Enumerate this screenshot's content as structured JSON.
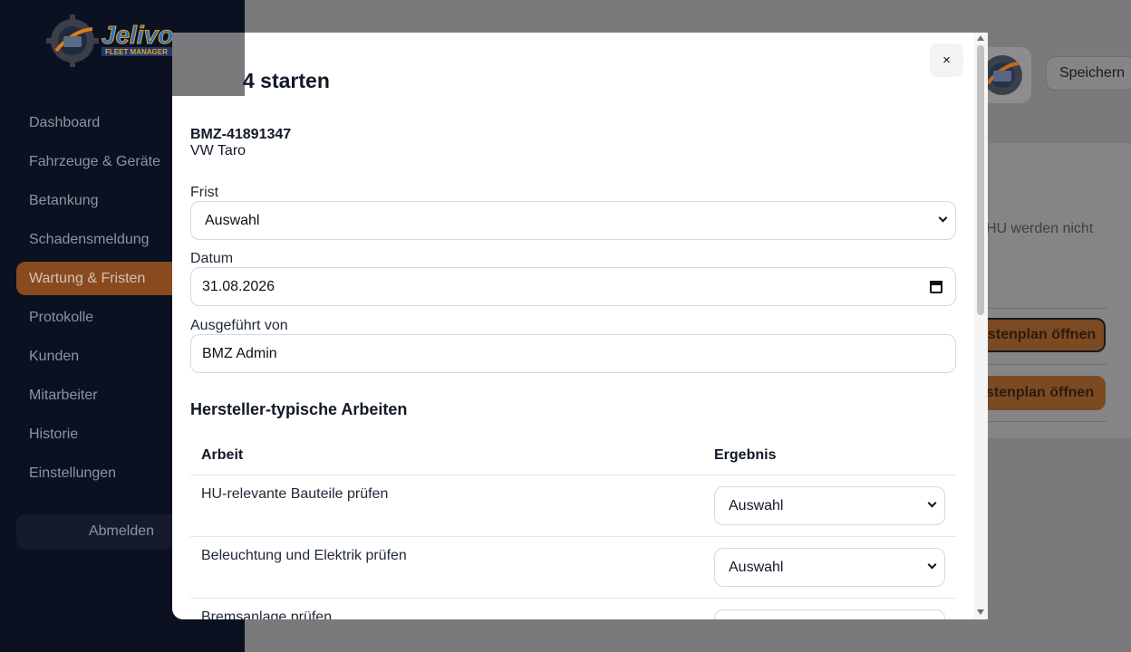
{
  "sidebar": {
    "nav": [
      {
        "label": "Dashboard"
      },
      {
        "label": "Fahrzeuge & Geräte"
      },
      {
        "label": "Betankung"
      },
      {
        "label": "Schadensmeldung"
      },
      {
        "label": "Wartung & Fristen"
      },
      {
        "label": "Protokolle"
      },
      {
        "label": "Kunden"
      },
      {
        "label": "Mitarbeiter"
      },
      {
        "label": "Historie"
      },
      {
        "label": "Einstellungen"
      }
    ],
    "active_index": 4,
    "logout_label": "Abmelden",
    "logo_alt_text": "Jelivo FLEET MANAGER"
  },
  "background": {
    "save_label": "Speichern",
    "info_text": "HU werden nicht",
    "btn1_label": "stenplan öffnen",
    "btn2_label": "stenplan öffnen"
  },
  "modal": {
    "title": "4 starten",
    "close_label": "×",
    "plate": "BMZ-41891347",
    "vehicle": "VW Taro",
    "frist_label": "Frist",
    "frist_value": "Auswahl",
    "datum_label": "Datum",
    "datum_value": "31.08.2026",
    "executed_label": "Ausgeführt von",
    "executed_value": "BMZ Admin",
    "section_title": "Hersteller-typische Arbeiten",
    "table": {
      "headers": [
        "Arbeit",
        "Ergebnis"
      ],
      "rows": [
        {
          "task": "HU-relevante Bauteile prüfen",
          "result": "Auswahl"
        },
        {
          "task": "Beleuchtung und Elektrik prüfen",
          "result": "Auswahl"
        },
        {
          "task": "Bremsanlage prüfen",
          "result": ""
        }
      ]
    }
  },
  "colors": {
    "sidebar_bg": "#0b1120",
    "accent": "#c2610d",
    "overlay": "#7a7a7c"
  }
}
